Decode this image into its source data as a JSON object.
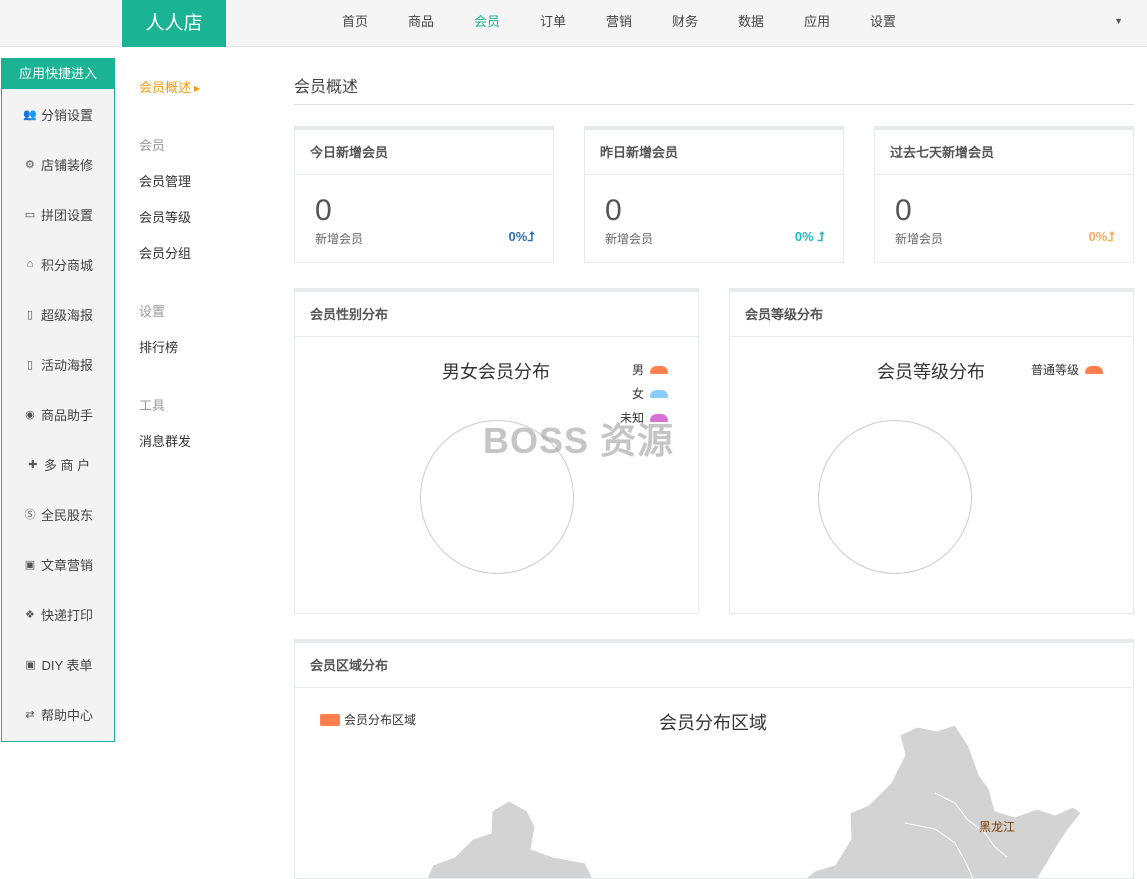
{
  "brand": "人人店",
  "nav": [
    "首页",
    "商品",
    "会员",
    "订单",
    "营销",
    "财务",
    "数据",
    "应用",
    "设置"
  ],
  "nav_active": 2,
  "quick_panel": {
    "title": "应用快捷进入",
    "items": [
      {
        "label": "分销设置",
        "icon": "users-icon"
      },
      {
        "label": "店铺装修",
        "icon": "gear-icon"
      },
      {
        "label": "拼团设置",
        "icon": "credit-card-icon"
      },
      {
        "label": "积分商城",
        "icon": "gift-icon"
      },
      {
        "label": "超级海报",
        "icon": "document-icon"
      },
      {
        "label": "活动海报",
        "icon": "file-audio-icon"
      },
      {
        "label": "商品助手",
        "icon": "cat-icon"
      },
      {
        "label": "多 商 户",
        "icon": "user-plus-icon"
      },
      {
        "label": "全民股东",
        "icon": "skype-icon"
      },
      {
        "label": "文章营销",
        "icon": "newspaper-icon"
      },
      {
        "label": "快递打印",
        "icon": "dropbox-icon"
      },
      {
        "label": "DIY 表单",
        "icon": "linkedin-icon"
      },
      {
        "label": "帮助中心",
        "icon": "retweet-icon"
      }
    ]
  },
  "submenu": {
    "overview": "会员概述",
    "group_member": "会员",
    "member_manage": "会员管理",
    "member_level": "会员等级",
    "member_group": "会员分组",
    "group_settings": "设置",
    "ranking": "排行榜",
    "group_tools": "工具",
    "broadcast": "消息群发"
  },
  "page_title": "会员概述",
  "stats": [
    {
      "title": "今日新增会员",
      "value": "0",
      "label": "新增会员",
      "pct": "0%",
      "color": "#2c6fb7"
    },
    {
      "title": "昨日新增会员",
      "value": "0",
      "label": "新增会员",
      "pct": "0%",
      "color": "#23b7c8"
    },
    {
      "title": "过去七天新增会员",
      "value": "0",
      "label": "新增会员",
      "pct": "0%",
      "color": "#f8ac59"
    }
  ],
  "gender_card": {
    "title": "会员性别分布",
    "chart_title": "男女会员分布",
    "legend": [
      {
        "name": "男",
        "color": "#ff7f50"
      },
      {
        "name": "女",
        "color": "#87cefa"
      },
      {
        "name": "未知",
        "color": "#da70d6"
      }
    ]
  },
  "level_card": {
    "title": "会员等级分布",
    "chart_title": "会员等级分布",
    "legend": [
      {
        "name": "普通等级",
        "color": "#ff7f50"
      }
    ]
  },
  "region_card": {
    "title": "会员区域分布",
    "chart_title": "会员分布区域",
    "legend": "会员分布区域",
    "legend_color": "#ff7f50",
    "map_labels": [
      "黑龙江"
    ]
  },
  "watermark": "BOSS 资源"
}
